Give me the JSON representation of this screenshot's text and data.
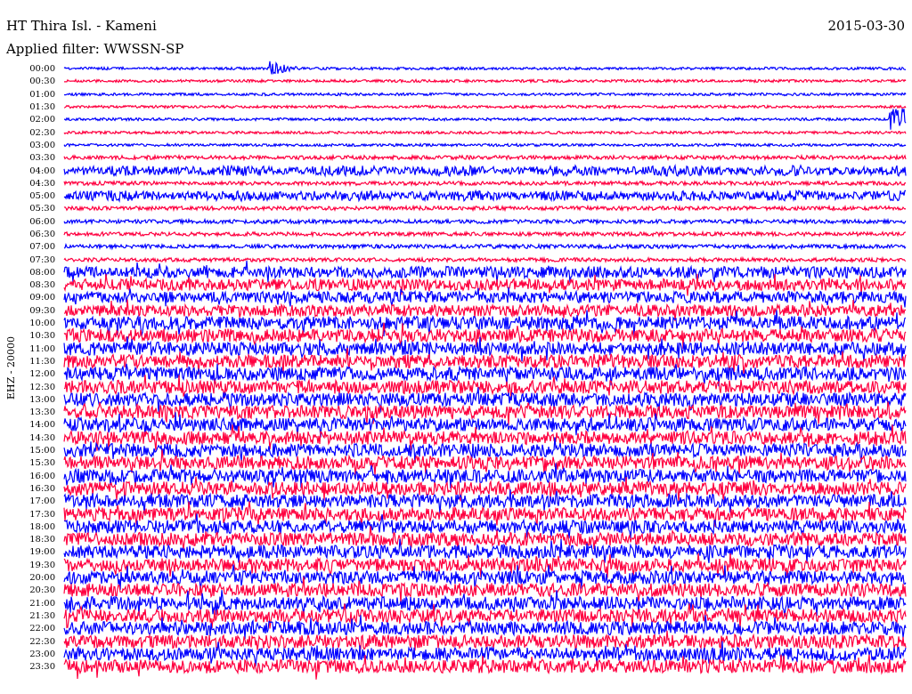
{
  "header": {
    "station": "HT Thira Isl. - Kameni",
    "date": "2015-03-30",
    "filter": "Applied filter: WWSSN-SP"
  },
  "channel_label": "EHZ - 20000",
  "rows": [
    {
      "time": "00:00",
      "color": "#0000ff"
    },
    {
      "time": "00:30",
      "color": "#ff0040"
    },
    {
      "time": "01:00",
      "color": "#0000ff"
    },
    {
      "time": "01:30",
      "color": "#ff0040"
    },
    {
      "time": "02:00",
      "color": "#0000ff"
    },
    {
      "time": "02:30",
      "color": "#ff0040"
    },
    {
      "time": "03:00",
      "color": "#0000ff"
    },
    {
      "time": "03:30",
      "color": "#ff0040"
    },
    {
      "time": "04:00",
      "color": "#0000ff"
    },
    {
      "time": "04:30",
      "color": "#ff0040"
    },
    {
      "time": "05:00",
      "color": "#0000ff"
    },
    {
      "time": "05:30",
      "color": "#ff0040"
    },
    {
      "time": "06:00",
      "color": "#0000ff"
    },
    {
      "time": "06:30",
      "color": "#ff0040"
    },
    {
      "time": "07:00",
      "color": "#0000ff"
    },
    {
      "time": "07:30",
      "color": "#ff0040"
    },
    {
      "time": "08:00",
      "color": "#0000ff"
    },
    {
      "time": "08:30",
      "color": "#ff0040"
    },
    {
      "time": "09:00",
      "color": "#0000ff"
    },
    {
      "time": "09:30",
      "color": "#ff0040"
    },
    {
      "time": "10:00",
      "color": "#0000ff"
    },
    {
      "time": "10:30",
      "color": "#ff0040"
    },
    {
      "time": "11:00",
      "color": "#0000ff"
    },
    {
      "time": "11:30",
      "color": "#ff0040"
    },
    {
      "time": "12:00",
      "color": "#0000ff"
    },
    {
      "time": "12:30",
      "color": "#ff0040"
    },
    {
      "time": "13:00",
      "color": "#0000ff"
    },
    {
      "time": "13:30",
      "color": "#ff0040"
    },
    {
      "time": "14:00",
      "color": "#0000ff"
    },
    {
      "time": "14:30",
      "color": "#ff0040"
    },
    {
      "time": "15:00",
      "color": "#0000ff"
    },
    {
      "time": "15:30",
      "color": "#ff0040"
    },
    {
      "time": "16:00",
      "color": "#0000ff"
    },
    {
      "time": "16:30",
      "color": "#ff0040"
    },
    {
      "time": "17:00",
      "color": "#0000ff"
    },
    {
      "time": "17:30",
      "color": "#ff0040"
    },
    {
      "time": "18:00",
      "color": "#0000ff"
    },
    {
      "time": "18:30",
      "color": "#ff0040"
    },
    {
      "time": "19:00",
      "color": "#0000ff"
    },
    {
      "time": "19:30",
      "color": "#ff0040"
    },
    {
      "time": "20:00",
      "color": "#0000ff"
    },
    {
      "time": "20:30",
      "color": "#ff0040"
    },
    {
      "time": "21:00",
      "color": "#0000ff"
    },
    {
      "time": "21:30",
      "color": "#ff0040"
    },
    {
      "time": "22:00",
      "color": "#0000ff"
    },
    {
      "time": "22:30",
      "color": "#ff0040"
    },
    {
      "time": "23:00",
      "color": "#0000ff"
    },
    {
      "time": "23:30",
      "color": "#ff0040"
    }
  ]
}
